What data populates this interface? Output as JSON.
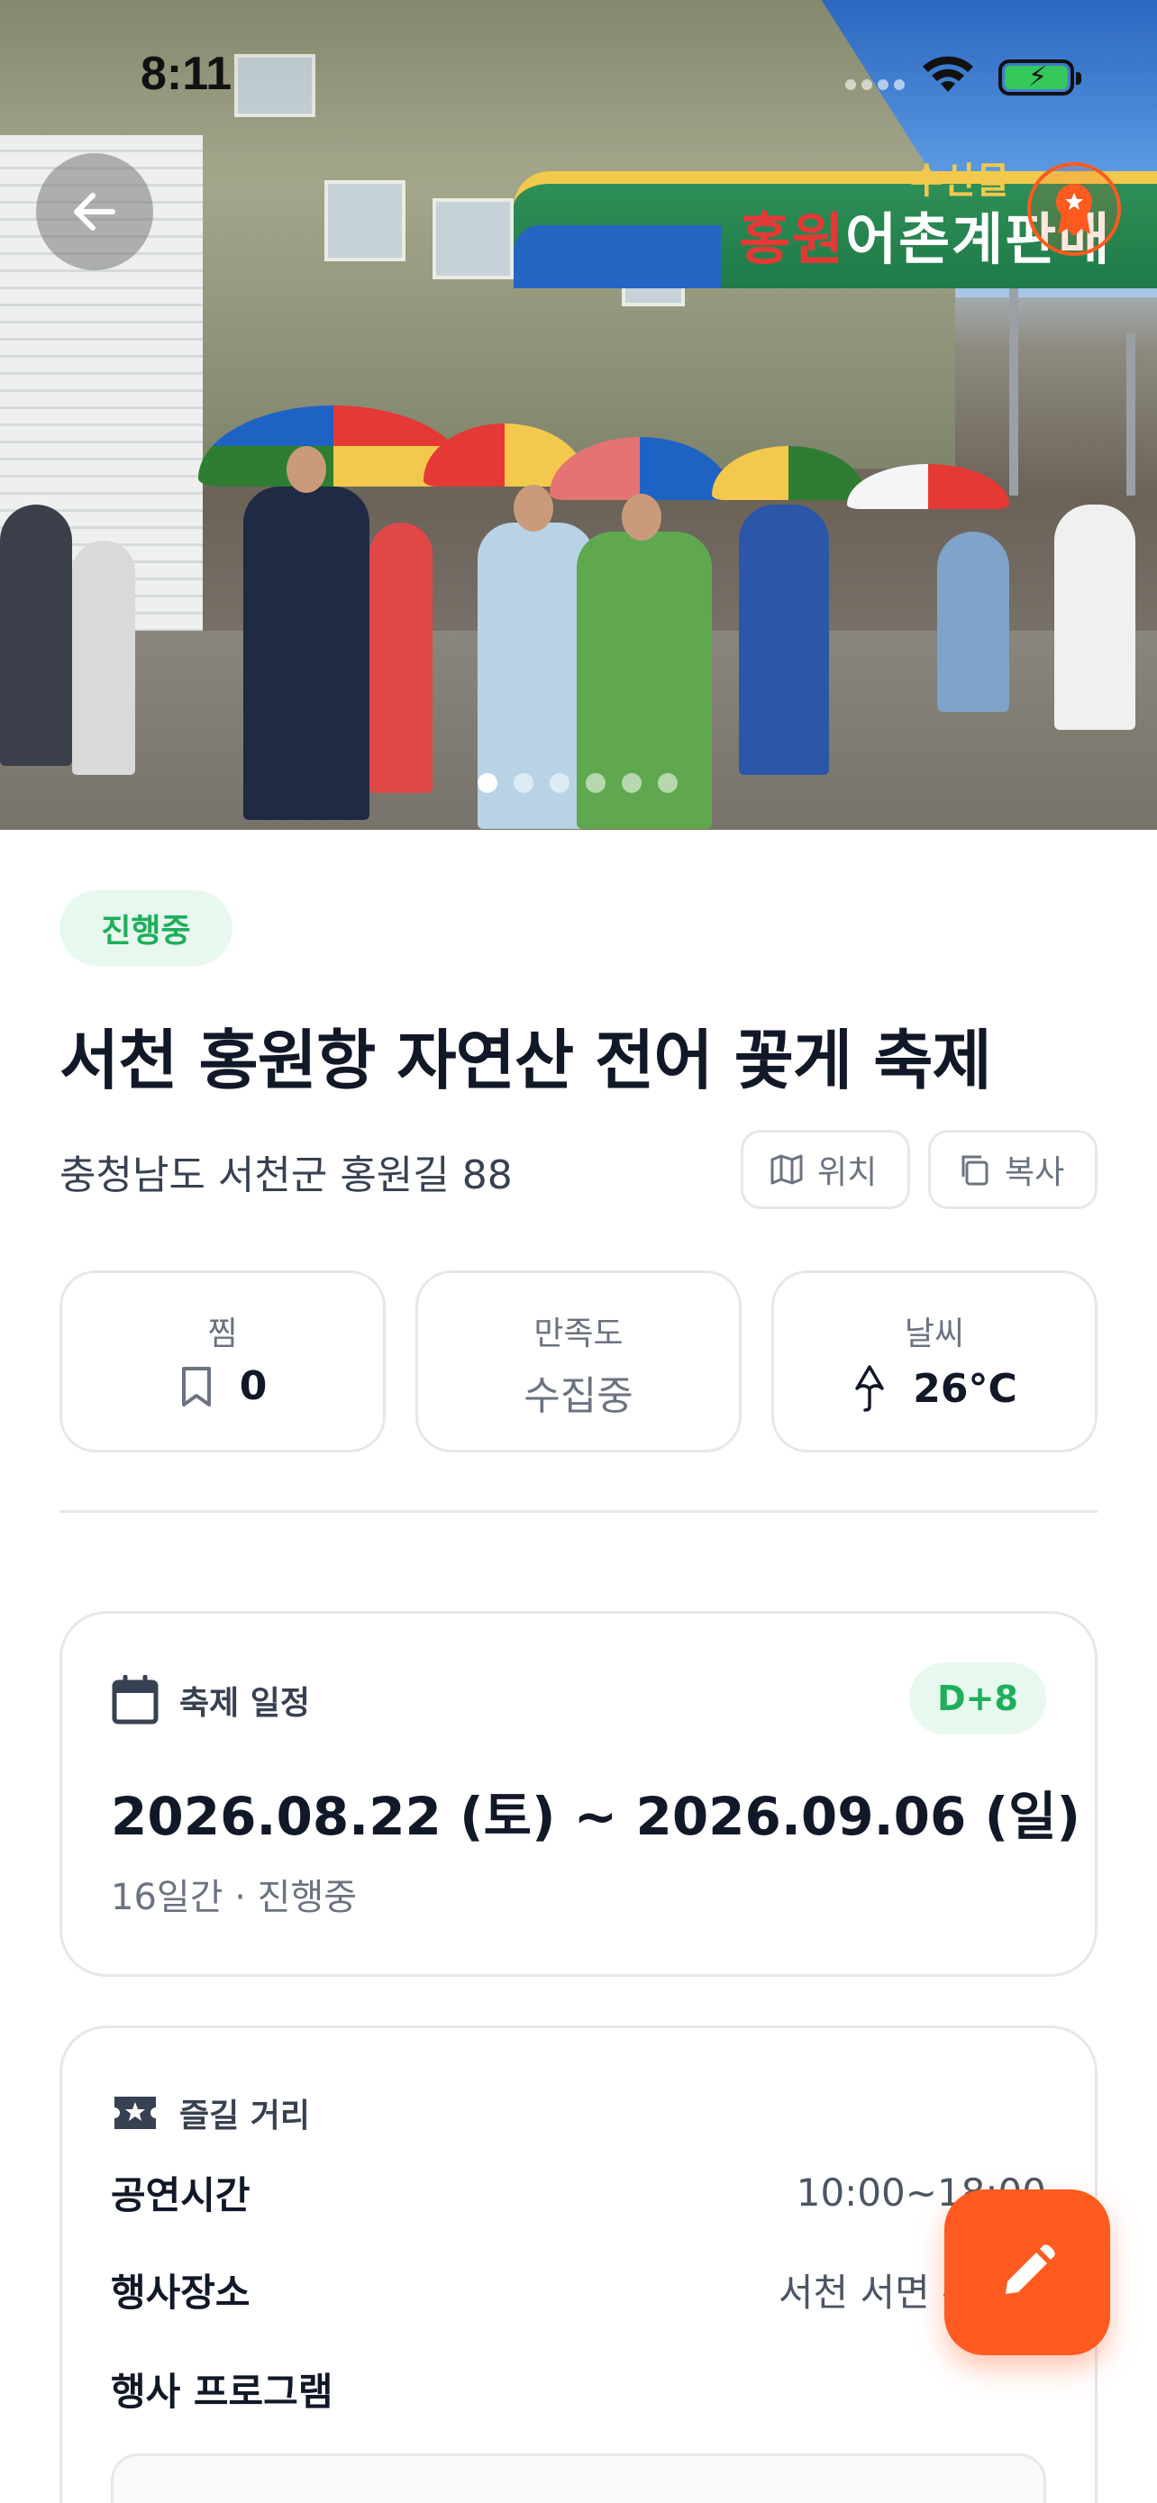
{
  "status_bar": {
    "time": "8:11"
  },
  "hero": {
    "arch_sign_top": "수산물",
    "arch_sign_red": "홍원",
    "arch_sign_main": "어촌계판매",
    "carousel_total": 6,
    "carousel_active": 1
  },
  "festival": {
    "status": "진행중",
    "title": "서천 홍원항 자연산 전어 꽃게 축제",
    "address": "충청남도 서천군 홍원길 88",
    "location_label": "위치",
    "copy_label": "복사"
  },
  "stats": {
    "likes": {
      "label": "찜",
      "value": "0"
    },
    "satisfaction": {
      "label": "만족도",
      "value": "수집중"
    },
    "weather": {
      "label": "날씨",
      "value": "26°C"
    }
  },
  "schedule": {
    "heading": "축제 일정",
    "dday": "D+8",
    "period": "2026.08.22 (토) ~ 2026.09.06 (일)",
    "summary": "16일간 · 진행중"
  },
  "enjoy": {
    "heading": "즐길 거리",
    "rows": [
      {
        "key": "공연시간",
        "value": "10:00~18:00"
      },
      {
        "key": "행사장소",
        "value": "서천 서면 홍원항"
      }
    ],
    "program_label": "행사 프로그램"
  },
  "colors": {
    "accent": "#ff5a1f",
    "status_green": "#1fae5b",
    "status_green_bg": "#e7f8ee"
  }
}
